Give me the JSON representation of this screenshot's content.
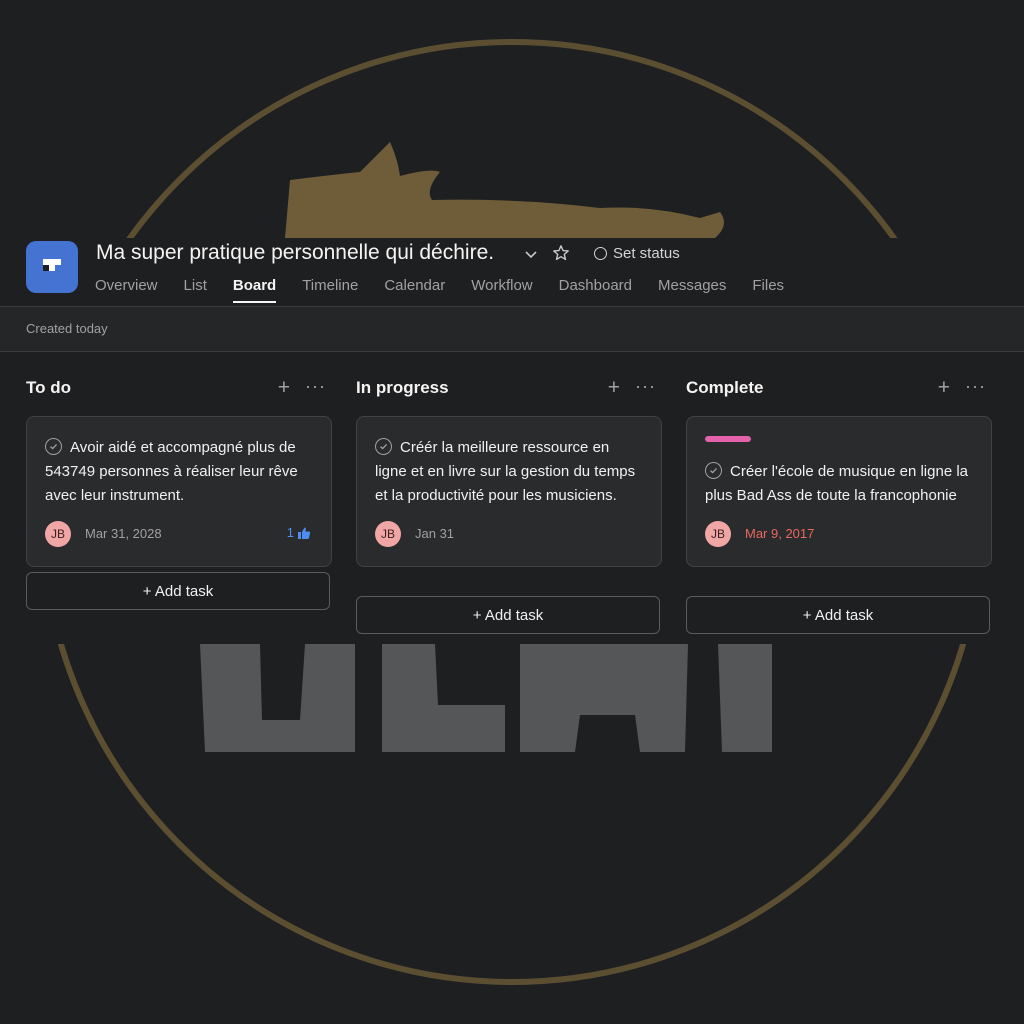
{
  "project": {
    "title": "Ma super pratique personnelle qui déchire.",
    "set_status": "Set status",
    "created": "Created today"
  },
  "tabs": [
    {
      "label": "Overview"
    },
    {
      "label": "List"
    },
    {
      "label": "Board",
      "active": true
    },
    {
      "label": "Timeline"
    },
    {
      "label": "Calendar"
    },
    {
      "label": "Workflow"
    },
    {
      "label": "Dashboard"
    },
    {
      "label": "Messages"
    },
    {
      "label": "Files"
    }
  ],
  "columns": [
    {
      "title": "To do",
      "add_task": "+ Add task",
      "card": {
        "text": "Avoir aidé et accompagné plus de 543749 personnes à réaliser leur rêve avec leur instrument.",
        "avatar": "JB",
        "due": "Mar 31, 2028",
        "likes": "1"
      }
    },
    {
      "title": "In progress",
      "add_task": "+ Add task",
      "card": {
        "text": "Créér la meilleure ressource en ligne et en livre sur la gestion du temps et la productivité pour les musiciens.",
        "avatar": "JB",
        "due": "Jan 31"
      }
    },
    {
      "title": "Complete",
      "add_task": "+ Add task",
      "card": {
        "text": "Créer l'école de musique en ligne la plus Bad Ass de toute la francophonie",
        "avatar": "JB",
        "due": "Mar 9, 2017",
        "tag_color": "#e362a9"
      }
    }
  ],
  "colors": {
    "accent": "#4573d2",
    "overdue": "#e8685f",
    "like": "#4d8ef0",
    "tag": "#e362a9",
    "avatar": "#f1a6a6"
  }
}
